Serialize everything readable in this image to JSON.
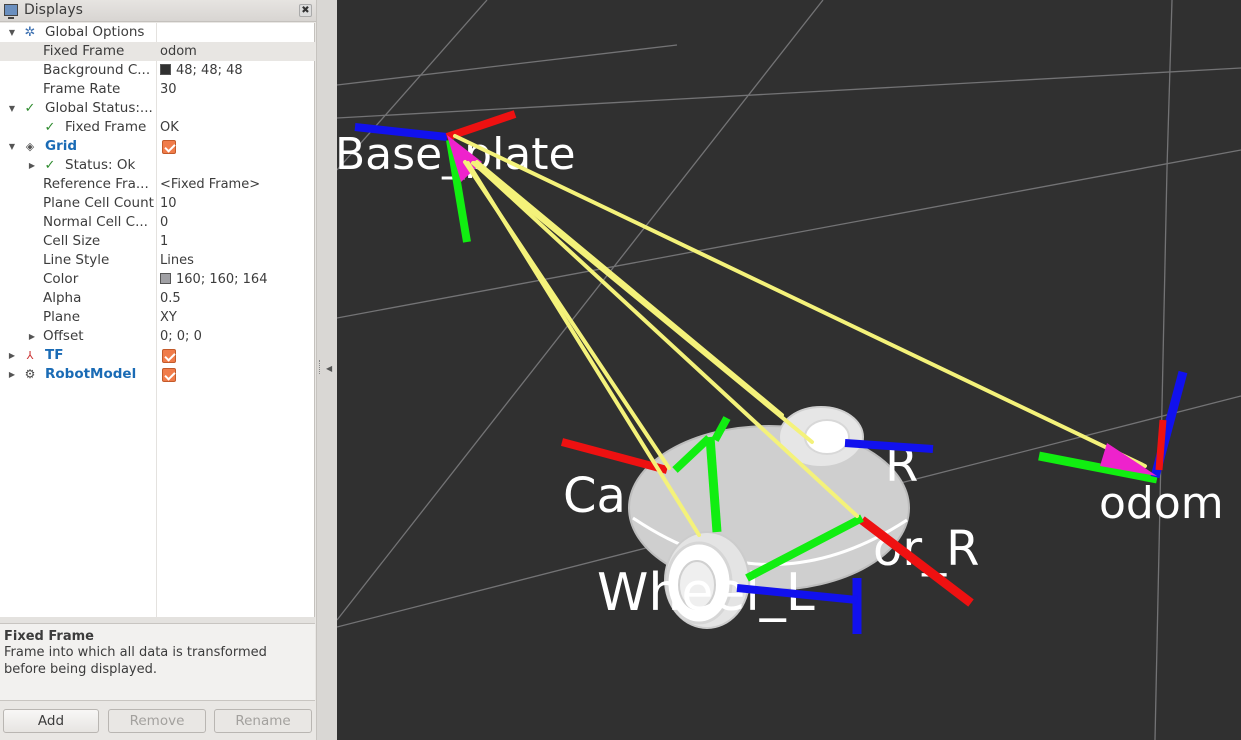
{
  "panel": {
    "title": "Displays",
    "close_glyph": "✖",
    "rows": [
      {
        "label": "Global Options",
        "value": ""
      },
      {
        "label": "Fixed Frame",
        "value": "odom"
      },
      {
        "label": "Background C...",
        "value": "48; 48; 48",
        "swatch": "#303030"
      },
      {
        "label": "Frame Rate",
        "value": "30"
      },
      {
        "label": "Global Status:...",
        "value": ""
      },
      {
        "label": "Fixed Frame",
        "value": "OK"
      },
      {
        "label": "Grid",
        "value": ""
      },
      {
        "label": "Status: Ok",
        "value": ""
      },
      {
        "label": "Reference Fra...",
        "value": "<Fixed Frame>"
      },
      {
        "label": "Plane Cell Count",
        "value": "10"
      },
      {
        "label": "Normal Cell C...",
        "value": "0"
      },
      {
        "label": "Cell Size",
        "value": "1"
      },
      {
        "label": "Line Style",
        "value": "Lines"
      },
      {
        "label": "Color",
        "value": "160; 160; 164",
        "swatch": "#a0a0a4"
      },
      {
        "label": "Alpha",
        "value": "0.5"
      },
      {
        "label": "Plane",
        "value": "XY"
      },
      {
        "label": "Offset",
        "value": "0; 0; 0"
      },
      {
        "label": "TF",
        "value": ""
      },
      {
        "label": "RobotModel",
        "value": ""
      }
    ]
  },
  "help": {
    "title": "Fixed Frame",
    "text": "Frame into which all data is transformed before being displayed."
  },
  "buttons": {
    "add": "Add",
    "remove": "Remove",
    "rename": "Rename"
  },
  "viewport": {
    "background": "#303030",
    "frame_labels": [
      "Base_plate",
      "odom",
      "Ca",
      "R",
      "or_R",
      "Wheel_L"
    ]
  },
  "colors": {
    "accent_blue": "#1a6bb5",
    "checkbox": "#f07c4a",
    "ok_green": "#2e8b2e"
  }
}
